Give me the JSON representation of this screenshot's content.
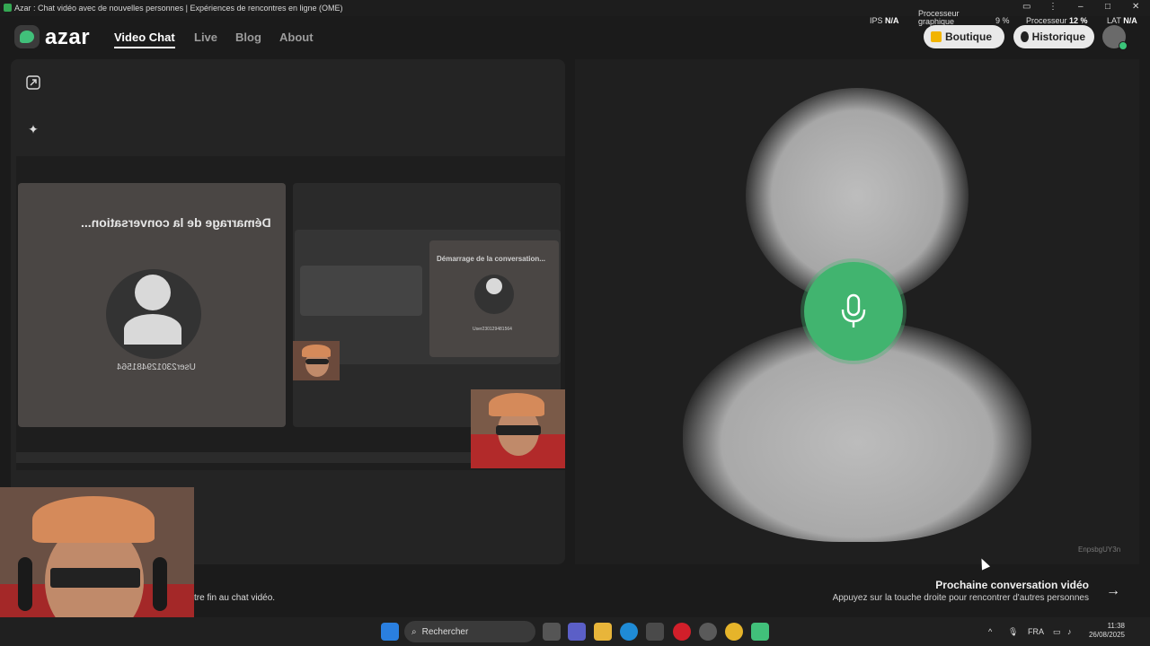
{
  "window": {
    "title": "Azar : Chat vidéo avec de nouvelles personnes | Expériences de rencontres en ligne (OME)"
  },
  "perf_overlay": {
    "ips_label": "IPS",
    "ips_value": "N/A",
    "gpu_label_1": "Processeur",
    "gpu_label_2": "graphique",
    "gpu_value": "9 %",
    "cpu_label": "Processeur",
    "cpu_value": "12 %",
    "lat_label": "LAT",
    "lat_value": "N/A"
  },
  "nav": {
    "logo_text": "azar",
    "links": [
      "Video Chat",
      "Live",
      "Blog",
      "About"
    ],
    "active_link": "Video Chat",
    "shop_label": "Boutique",
    "history_label": "Historique"
  },
  "mirror": {
    "status_title": "Démarrage de la conversation...",
    "user_id": "User230129481564",
    "inner_status_title": "Démarrage de la conversation...",
    "inner_user_id": "User230129481564"
  },
  "right": {
    "next_title": "Prochaine conversation vidéo",
    "next_subtitle": "Appuyez sur la touche droite pour rencontrer d'autres personnes",
    "user_code": "EnpsbgUY3n"
  },
  "left_footer": {
    "end_text": "tre fin au chat vidéo."
  },
  "taskbar": {
    "search_placeholder": "Rechercher",
    "lang": "FRA",
    "time": "11:38",
    "date": "26/08/2025"
  },
  "colors": {
    "accent_green": "#41b46f",
    "background": "#1b1b1b"
  },
  "icons": [
    "expand-icon",
    "sparkle-icon",
    "mic-icon",
    "arrow-right-icon",
    "search-icon",
    "shop-icon",
    "history-icon"
  ]
}
